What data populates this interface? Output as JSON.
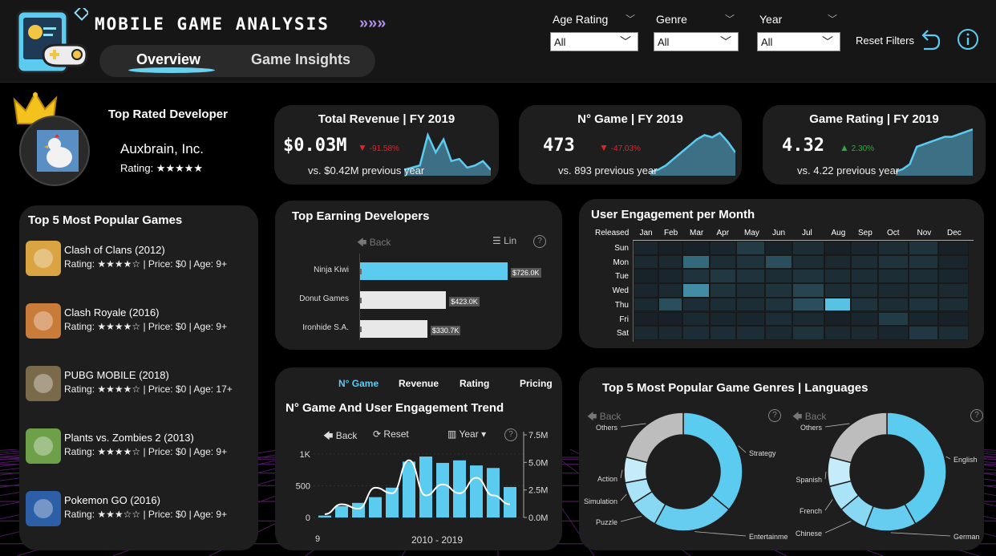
{
  "header": {
    "title": "MOBILE GAME ANALYSIS",
    "title_arrows": "»»»",
    "tabs": [
      {
        "label": "Overview",
        "active": true
      },
      {
        "label": "Game Insights",
        "active": false
      }
    ],
    "filters": [
      {
        "label": "Age Rating",
        "value": "All"
      },
      {
        "label": "Genre",
        "value": "All"
      },
      {
        "label": "Year",
        "value": "All"
      }
    ],
    "reset_label": "Reset Filters"
  },
  "top_developer": {
    "title": "Top Rated Developer",
    "name": "Auxbrain, Inc.",
    "rating": "Rating: ★★★★★"
  },
  "kpis": [
    {
      "title": "Total Revenue | FY 2019",
      "value": "$0.03M",
      "delta": "-91.58%",
      "direction": "down",
      "prev": "vs. $0.42M previous year",
      "spark": [
        0.1,
        0.15,
        0.2,
        0.9,
        0.5,
        0.8,
        0.3,
        0.35,
        0.15,
        0.2,
        0.3,
        0.1
      ]
    },
    {
      "title": "N° Game | FY 2019",
      "value": "473",
      "delta": "-47.03%",
      "direction": "down",
      "prev": "vs. 893 previous year",
      "spark": [
        0.05,
        0.1,
        0.2,
        0.35,
        0.5,
        0.65,
        0.8,
        0.9,
        0.85,
        0.95,
        0.75,
        0.5
      ]
    },
    {
      "title": "Game Rating | FY 2019",
      "value": "4.32",
      "delta": "2.30%",
      "direction": "up",
      "prev": "vs. 4.22 previous year",
      "spark": [
        0.05,
        0.1,
        0.2,
        0.55,
        0.6,
        0.65,
        0.7,
        0.75,
        0.75,
        0.8,
        0.85,
        0.9
      ]
    }
  ],
  "popular_games": {
    "title": "Top 5 Most Popular Games",
    "items": [
      {
        "name": "Clash of Clans (2012)",
        "meta": "Rating: ★★★★☆ | Price: $0 | Age: 9+",
        "icon": "clash-of-clans-icon",
        "color": "#d9a441"
      },
      {
        "name": "Clash Royale (2016)",
        "meta": "Rating: ★★★★☆ | Price: $0 | Age: 9+",
        "icon": "clash-royale-icon",
        "color": "#c97c3a"
      },
      {
        "name": "PUBG MOBILE (2018)",
        "meta": "Rating: ★★★★☆ | Price: $0 | Age: 17+",
        "icon": "pubg-mobile-icon",
        "color": "#7b6a4a"
      },
      {
        "name": "Plants vs. Zombies 2 (2013)",
        "meta": "Rating: ★★★★☆ | Price: $0 | Age: 9+",
        "icon": "plants-vs-zombies-icon",
        "color": "#6ea04a"
      },
      {
        "name": "Pokemon GO (2016)",
        "meta": "Rating: ★★★☆☆ | Price: $0 | Age: 9+",
        "icon": "pokemon-go-icon",
        "color": "#2c5fa8"
      }
    ]
  },
  "earning_devs": {
    "title": "Top Earning Developers",
    "back_label": "Back",
    "lin_label": "Lin",
    "question": "?"
  },
  "engagement": {
    "title": "User Engagement per Month",
    "col_header": "Released",
    "days": [
      "Sun",
      "Mon",
      "Tue",
      "Wed",
      "Thu",
      "Fri",
      "Sat"
    ]
  },
  "trend": {
    "title": "N° Game And User Engagement Trend",
    "toggles": [
      "N° Game",
      "Revenue",
      "Rating",
      "Pricing"
    ],
    "back_label": "Back",
    "reset_label": "Reset",
    "year_label": "Year",
    "question": "?"
  },
  "genres": {
    "title": "Top 5 Most Popular Game Genres | Languages",
    "back_label": "Back",
    "question": "?"
  },
  "colors": {
    "accent": "#5ccbf0",
    "card": "#1e1e1e",
    "down": "#e0242c",
    "up": "#2eaa3e"
  },
  "chart_data": [
    {
      "type": "bar",
      "title": "Top Earning Developers",
      "categories": [
        "Ninja Kiwi",
        "Donut Games",
        "Ironhide S.A."
      ],
      "values": [
        726.0,
        423.0,
        330.7
      ],
      "value_labels": [
        "$726.0K",
        "$423.0K",
        "$330.7K"
      ],
      "orientation": "horizontal"
    },
    {
      "type": "heatmap",
      "title": "User Engagement per Month",
      "x": [
        "Jan",
        "Feb",
        "Mar",
        "Apr",
        "May",
        "Jun",
        "Jul",
        "Aug",
        "Sep",
        "Oct",
        "Nov",
        "Dec"
      ],
      "y": [
        "Sun",
        "Mon",
        "Tue",
        "Wed",
        "Thu",
        "Fri",
        "Sat"
      ],
      "values": [
        [
          0.08,
          0.05,
          0.05,
          0.08,
          0.2,
          0.06,
          0.12,
          0.05,
          0.08,
          0.12,
          0.15,
          0.05
        ],
        [
          0.1,
          0.1,
          0.45,
          0.12,
          0.15,
          0.3,
          0.12,
          0.1,
          0.12,
          0.15,
          0.15,
          0.08
        ],
        [
          0.06,
          0.08,
          0.15,
          0.18,
          0.15,
          0.12,
          0.15,
          0.12,
          0.12,
          0.12,
          0.12,
          0.08
        ],
        [
          0.08,
          0.1,
          0.65,
          0.15,
          0.12,
          0.15,
          0.25,
          0.12,
          0.12,
          0.1,
          0.12,
          0.1
        ],
        [
          0.1,
          0.3,
          0.12,
          0.12,
          0.12,
          0.15,
          0.3,
          0.95,
          0.15,
          0.12,
          0.15,
          0.12
        ],
        [
          0.05,
          0.05,
          0.1,
          0.08,
          0.08,
          0.12,
          0.1,
          0.05,
          0.08,
          0.2,
          0.08,
          0.05
        ],
        [
          0.1,
          0.1,
          0.12,
          0.12,
          0.12,
          0.1,
          0.15,
          0.1,
          0.1,
          0.08,
          0.18,
          0.12
        ]
      ]
    },
    {
      "type": "bar",
      "title": "N° Game And User Engagement Trend",
      "xlabel": "2010 - 2019",
      "series": [
        {
          "values": [
            30,
            180,
            230,
            320,
            470,
            880,
            960,
            860,
            900,
            820,
            780,
            480
          ],
          "axis": "left"
        },
        {
          "values": [
            0.3,
            1.2,
            0.8,
            2.7,
            2.2,
            5.2,
            2.0,
            3.0,
            2.2,
            3.6,
            2.0,
            1.2
          ],
          "axis": "right",
          "kind": "line"
        }
      ],
      "ylim": [
        0,
        1150
      ],
      "y_ticks": [
        "1K",
        "500",
        "0"
      ],
      "y2_ticks": [
        "7.5M",
        "5.0M",
        "2.5M",
        "0.0M"
      ],
      "first_tick": "9"
    },
    {
      "type": "pie",
      "title": "Genres",
      "categories": [
        "Strategy",
        "Entertainme",
        "Puzzle",
        "Simulation",
        "Action",
        "Others"
      ],
      "values": [
        36,
        22,
        8,
        6,
        7,
        21
      ]
    },
    {
      "type": "pie",
      "title": "Languages",
      "categories": [
        "English",
        "German",
        "Chinese",
        "French",
        "Spanish",
        "Others"
      ],
      "values": [
        42,
        14,
        8,
        7,
        8,
        21
      ]
    }
  ]
}
